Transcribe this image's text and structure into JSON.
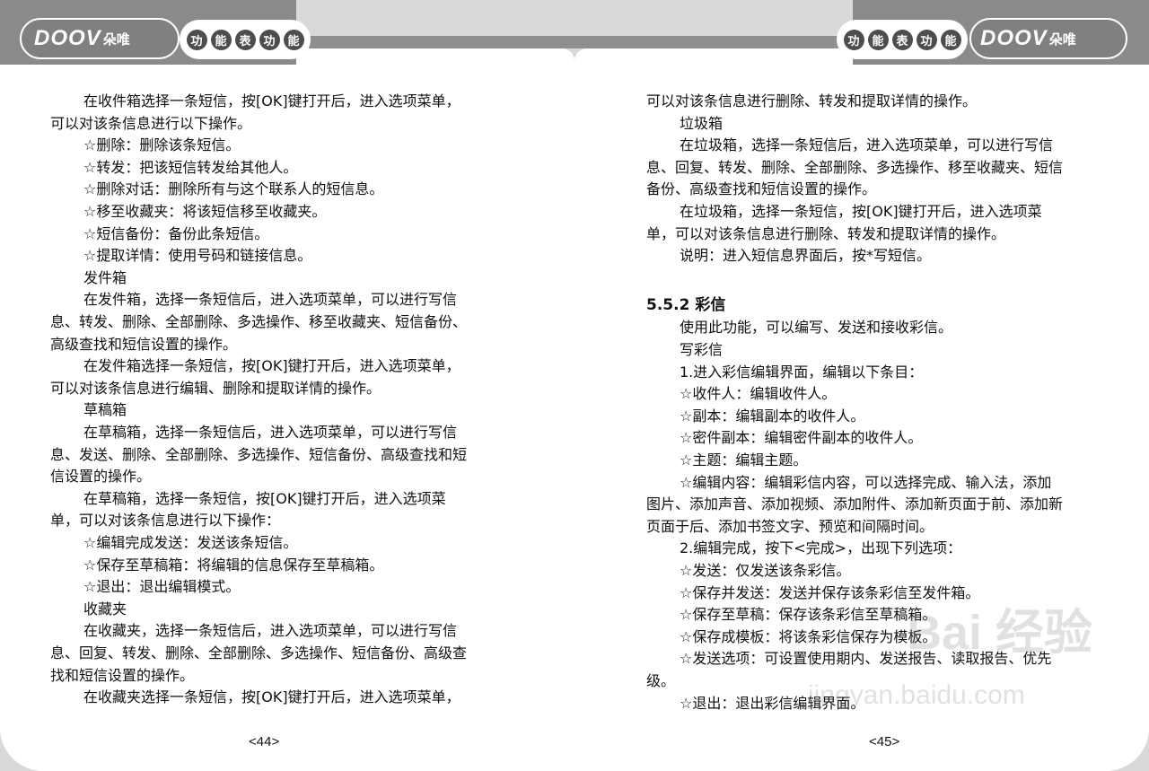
{
  "header": {
    "brand_latin": "DOOV",
    "brand_cn": "朵唯",
    "section_chars": [
      "功",
      "能",
      "表",
      "功",
      "能"
    ]
  },
  "left_page": {
    "lines": [
      "在收件箱选择一条短信，按[OK]键打开后，进入选项菜单，",
      "可以对该条信息进行以下操作。",
      "☆删除：删除该条短信。",
      "☆转发：把该短信转发给其他人。",
      "☆删除对话：删除所有与这个联系人的短信息。",
      "☆移至收藏夹：将该短信移至收藏夹。",
      "☆短信备份：备份此条短信。",
      "☆提取详情：使用号码和链接信息。",
      "发件箱",
      "在发件箱，选择一条短信后，进入选项菜单，可以进行写信",
      "息、转发、删除、全部删除、多选操作、移至收藏夹、短信备份、",
      "高级查找和短信设置的操作。",
      "在发件箱选择一条短信，按[OK]键打开后，进入选项菜单，",
      "可以对该条信息进行编辑、删除和提取详情的操作。",
      "草稿箱",
      "在草稿箱，选择一条短信后，进入选项菜单，可以进行写信",
      "息、发送、删除、全部删除、多选操作、短信备份、高级查找和短",
      "信设置的操作。",
      "在草稿箱，选择一条短信，按[OK]键打开后，进入选项菜",
      "单，可以对该条信息进行以下操作：",
      "☆编辑完成发送：发送该条短信。",
      "☆保存至草稿箱：将编辑的信息保存至草稿箱。",
      "☆退出：退出编辑模式。",
      "收藏夹",
      "在收藏夹，选择一条短信后，进入选项菜单，可以进行写信",
      "息、回复、转发、删除、全部删除、多选操作、短信备份、高级查",
      "找和短信设置的操作。",
      "在收藏夹选择一条短信，按[OK]键打开后，进入选项菜单，"
    ],
    "page_number": "<44>"
  },
  "right_page": {
    "lines_top": [
      "可以对该条信息进行删除、转发和提取详情的操作。",
      "垃圾箱",
      "在垃圾箱，选择一条短信后，进入选项菜单，可以进行写信",
      "息、回复、转发、删除、全部删除、多选操作、移至收藏夹、短信",
      "备份、高级查找和短信设置的操作。",
      "在垃圾箱，选择一条短信，按[OK]键打开后，进入选项菜",
      "单，可以对该条信息进行删除、转发和提取详情的操作。",
      "说明：进入短信息界面后，按*写短信。"
    ],
    "section_title": "5.5.2 彩信",
    "lines_bottom": [
      "使用此功能，可以编写、发送和接收彩信。",
      "写彩信",
      "1.进入彩信编辑界面，编辑以下条目：",
      "☆收件人：编辑收件人。",
      "☆副本：编辑副本的收件人。",
      "☆密件副本：编辑密件副本的收件人。",
      "☆主题：编辑主题。",
      "☆编辑内容：编辑彩信内容，可以选择完成、输入法，添加",
      "图片、添加声音、添加视频、添加附件、添加新页面于前、添加新",
      "页面于后、添加书签文字、预览和间隔时间。",
      "2.编辑完成，按下<完成>，出现下列选项：",
      "☆发送：仅发送该条彩信。",
      "☆保存并发送：发送并保存该条彩信至发件箱。",
      "☆保存至草稿：保存该条彩信至草稿箱。",
      "☆保存成模板：将该条彩信保存为模板。",
      "☆发送选项：可设置使用期内、发送报告、读取报告、优先",
      "级。",
      "☆退出：退出彩信编辑界面。"
    ],
    "page_number": "<45>"
  },
  "watermark": {
    "line1": "Bai 经验",
    "line2": "jingyan.baidu.com"
  }
}
